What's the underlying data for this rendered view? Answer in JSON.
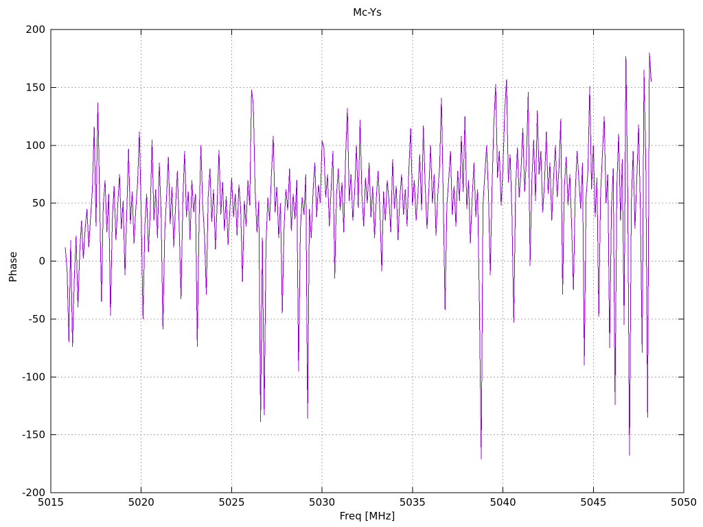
{
  "chart": {
    "title": "Mc-Ys",
    "xlabel": "Freq [MHz]",
    "ylabel": "Phase"
  },
  "colors": {
    "line": "#9400d3",
    "grid": "#a8a8a8",
    "axis": "#000000",
    "background": "#ffffff"
  },
  "chart_data": {
    "type": "line",
    "title": "Mc-Ys",
    "xlabel": "Freq [MHz]",
    "ylabel": "Phase",
    "xlim": [
      5015,
      5050
    ],
    "ylim": [
      -200,
      200
    ],
    "xticks": [
      5015,
      5020,
      5025,
      5030,
      5035,
      5040,
      5045,
      5050
    ],
    "yticks": [
      -200,
      -150,
      -100,
      -50,
      0,
      50,
      100,
      150,
      200
    ],
    "grid": true,
    "legend": false,
    "line_color": "#9400d3",
    "series": [
      {
        "name": "phase",
        "x_start": 5015.8,
        "x_step": 0.1,
        "y": [
          12,
          -8,
          -70,
          18,
          -74,
          -15,
          22,
          -40,
          8,
          35,
          2,
          28,
          45,
          12,
          38,
          62,
          116,
          30,
          137,
          55,
          -35,
          48,
          70,
          25,
          58,
          -47,
          35,
          65,
          18,
          48,
          75,
          28,
          52,
          -12,
          42,
          97,
          32,
          60,
          15,
          45,
          68,
          112,
          40,
          -50,
          30,
          58,
          8,
          44,
          105,
          35,
          62,
          20,
          85,
          40,
          -59,
          25,
          55,
          90,
          32,
          64,
          12,
          48,
          78,
          30,
          -33,
          52,
          95,
          38,
          60,
          18,
          70,
          42,
          58,
          -74,
          35,
          100,
          48,
          22,
          -29,
          55,
          80,
          34,
          62,
          10,
          50,
          96,
          40,
          68,
          26,
          56,
          14,
          44,
          72,
          38,
          58,
          22,
          66,
          45,
          -18,
          52,
          30,
          70,
          48,
          148,
          135,
          60,
          25,
          52,
          -139,
          20,
          -133,
          15,
          55,
          35,
          75,
          108,
          42,
          64,
          20,
          50,
          -45,
          30,
          62,
          44,
          80,
          26,
          58,
          36,
          70,
          -95,
          28,
          55,
          40,
          75,
          -136,
          45,
          20,
          60,
          85,
          38,
          66,
          50,
          104,
          98,
          55,
          75,
          30,
          62,
          95,
          -15,
          58,
          80,
          44,
          68,
          25,
          90,
          132,
          52,
          75,
          35,
          60,
          100,
          46,
          122,
          58,
          30,
          72,
          50,
          85,
          38,
          65,
          20,
          55,
          78,
          42,
          -9,
          60,
          35,
          70,
          52,
          25,
          88,
          45,
          65,
          18,
          55,
          75,
          40,
          62,
          30,
          80,
          115,
          48,
          70,
          35,
          58,
          92,
          44,
          117,
          65,
          28,
          60,
          100,
          50,
          75,
          22,
          58,
          82,
          141,
          55,
          -42,
          48,
          70,
          95,
          40,
          65,
          30,
          78,
          52,
          108,
          60,
          125,
          45,
          70,
          15,
          55,
          85,
          38,
          62,
          -38,
          -171,
          50,
          75,
          100,
          58,
          -12,
          65,
          120,
          153,
          72,
          95,
          48,
          80,
          130,
          157,
          68,
          92,
          40,
          -53,
          62,
          98,
          55,
          78,
          115,
          60,
          88,
          146,
          -4,
          70,
          105,
          52,
          130,
          75,
          95,
          42,
          68,
          112,
          58,
          85,
          35,
          72,
          100,
          55,
          80,
          123,
          -29,
          65,
          90,
          48,
          75,
          30,
          -25,
          60,
          95,
          70,
          45,
          85,
          -90,
          55,
          78,
          151,
          62,
          100,
          38,
          72,
          -48,
          58,
          92,
          125,
          50,
          75,
          -75,
          45,
          80,
          -124,
          65,
          110,
          35,
          88,
          -55,
          177,
          60,
          -168,
          52,
          95,
          28,
          70,
          118,
          45,
          -79,
          165,
          85,
          -135,
          180,
          155
        ]
      }
    ]
  }
}
